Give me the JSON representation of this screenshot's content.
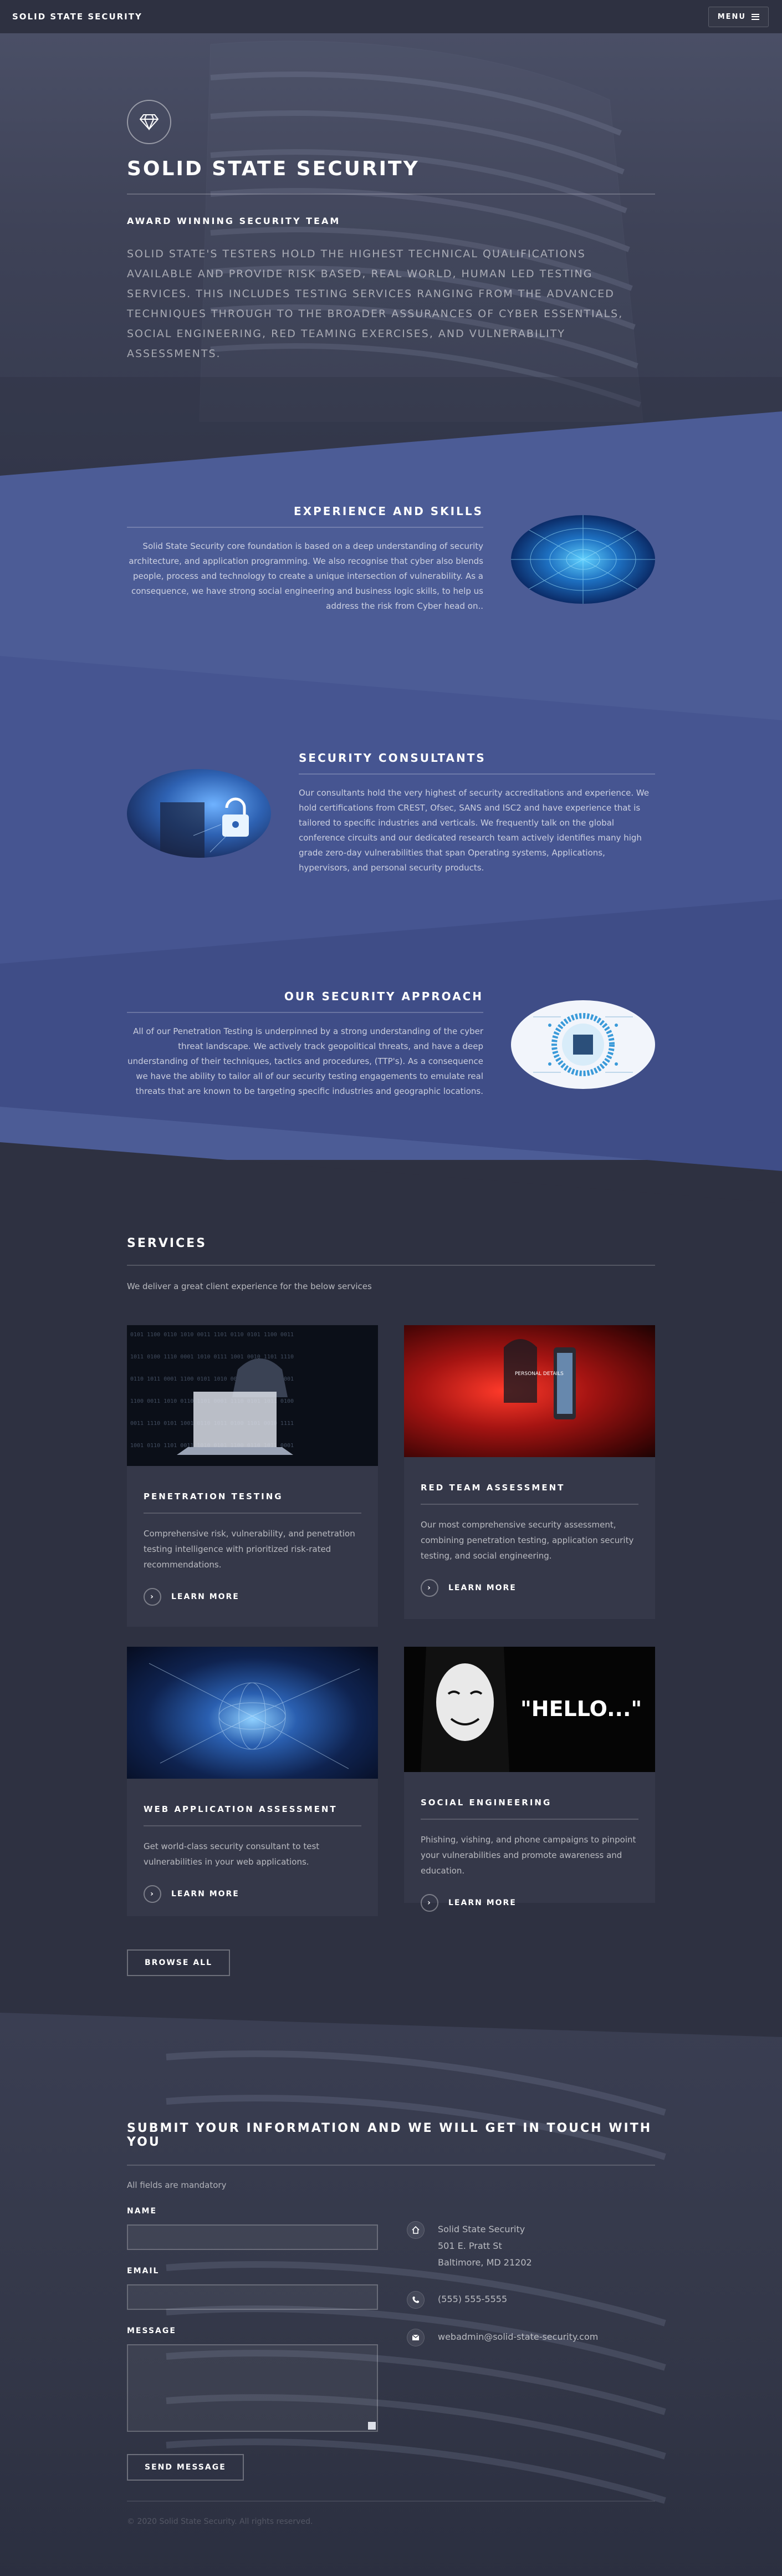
{
  "header": {
    "brand": "SOLID STATE SECURITY",
    "menu_label": "MENU"
  },
  "hero": {
    "logo_icon": "diamond-icon",
    "title": "SOLID STATE SECURITY",
    "subtitle": "AWARD WINNING SECURITY TEAM",
    "text": "SOLID STATE'S TESTERS HOLD THE HIGHEST TECHNICAL QUALIFICATIONS AVAILABLE AND PROVIDE RISK BASED, REAL WORLD, HUMAN LED TESTING SERVICES. THIS INCLUDES TESTING SERVICES RANGING FROM THE ADVANCED TECHNIQUES THROUGH TO THE BROADER ASSURANCES OF CYBER ESSENTIALS, SOCIAL ENGINEERING, RED TEAMING EXERCISES, AND VULNERABILITY ASSESSMENTS."
  },
  "features": [
    {
      "title": "EXPERIENCE AND SKILLS",
      "text": "Solid State Security core foundation is based on a deep understanding of security architecture, and application programming. We also recognise that cyber also blends people, process and technology to create a unique intersection of vulnerability. As a consequence, we have strong social engineering and business logic skills, to help us address the risk from Cyber head on.."
    },
    {
      "title": "SECURITY CONSULTANTS",
      "text": "Our consultants hold the very highest of security accreditations and experience. We hold certifications from CREST, Ofsec, SANS and ISC2 and have experience that is tailored to specific industries and verticals. We frequently talk on the global conference circuits and our dedicated research team actively identifies many high grade zero-day vulnerabilities that span Operating systems, Applications, hypervisors, and personal security products."
    },
    {
      "title": "OUR SECURITY APPROACH",
      "text": "All of our Penetration Testing is underpinned by a strong understanding of the cyber threat landscape. We actively track geopolitical threats, and have a deep understanding of their techniques, tactics and procedures, (TTP's). As a consequence we have the ability to tailor all of our security testing engagements to emulate real threats that are known to be targeting specific industries and geographic locations."
    }
  ],
  "services": {
    "title": "SERVICES",
    "lead": "We deliver a great client experience for the below services",
    "cards": [
      {
        "title": "PENETRATION TESTING",
        "text": "Comprehensive risk, vulnerability, and penetration testing intelligence with prioritized risk-rated recommendations.",
        "link": "LEARN MORE"
      },
      {
        "title": "RED TEAM ASSESSMENT",
        "text": "Our most comprehensive security assessment, combining penetration testing, application security testing, and social engineering.",
        "link": "LEARN MORE",
        "image_text": "PERSONAL DETAILS"
      },
      {
        "title": "WEB APPLICATION ASSESSMENT",
        "text": "Get world-class security consultant to test vulnerabilities in your web applications.",
        "link": "LEARN MORE"
      },
      {
        "title": "SOCIAL ENGINEERING",
        "text": "Phishing, vishing, and phone campaigns to pinpoint your vulnerabilities and promote awareness and education.",
        "link": "LEARN MORE",
        "image_text": "\"HELLO...\""
      }
    ],
    "browse_label": "BROWSE ALL"
  },
  "contact": {
    "title": "SUBMIT YOUR INFORMATION AND WE WILL GET IN TOUCH WITH YOU",
    "note": "All fields are mandatory",
    "name_label": "NAME",
    "email_label": "EMAIL",
    "message_label": "MESSAGE",
    "send_label": "SEND MESSAGE",
    "address_lines": [
      "Solid State Security",
      "501 E. Pratt St",
      "Baltimore, MD 21202"
    ],
    "phone": "(555) 555-5555",
    "email": "webadmin@solid-state-security.com",
    "copyright": "© 2020 Solid State Security. All rights reserved."
  }
}
